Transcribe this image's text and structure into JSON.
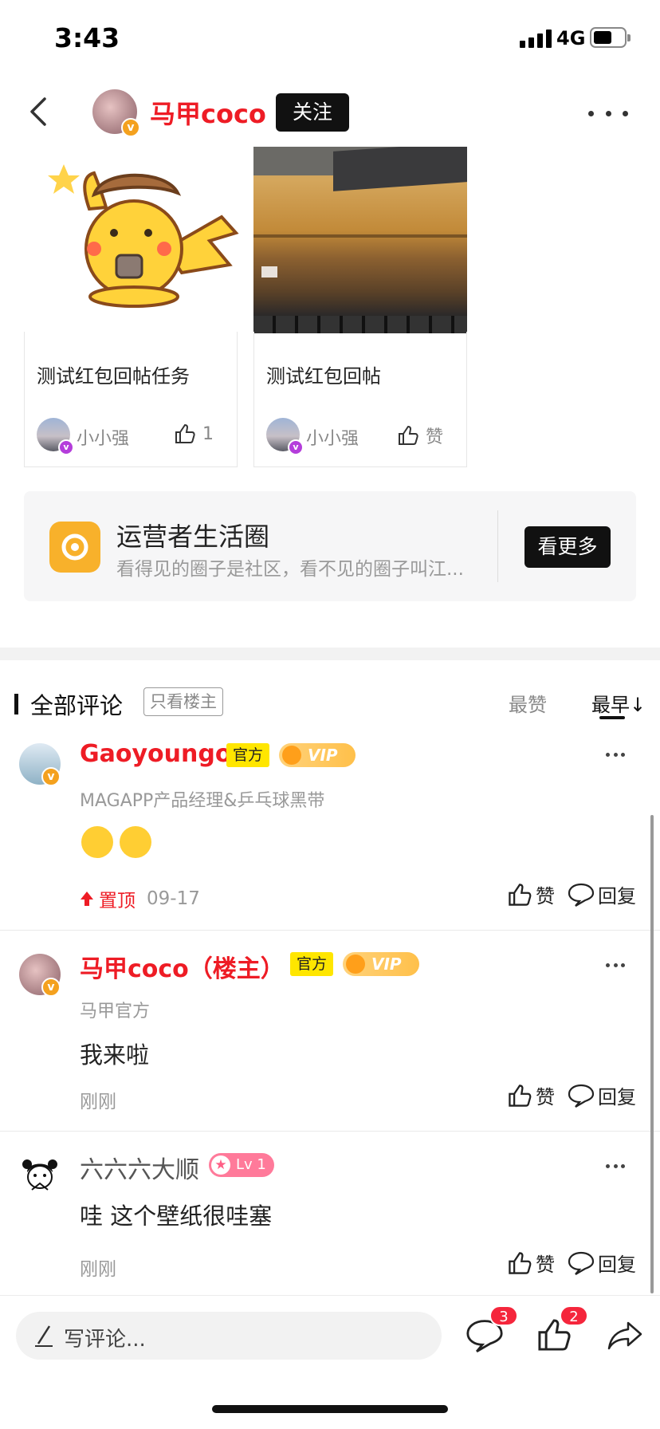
{
  "status_bar": {
    "time": "3:43",
    "network": "4G"
  },
  "header": {
    "author_name": "马甲coco",
    "follow_label": "关注"
  },
  "cards": [
    {
      "title": "测试红包回帖任务",
      "user": "小小强",
      "like_label": "1"
    },
    {
      "title": "测试红包回帖",
      "user": "小小强",
      "like_label": "赞"
    }
  ],
  "circle": {
    "title": "运营者生活圈",
    "description": "看得见的圈子是社区，看不见的圈子叫江...",
    "see_more_label": "看更多"
  },
  "comments_header": {
    "label": "全部评论",
    "only_op_label": "只看楼主",
    "sort_top_label": "最赞",
    "sort_early_label": "最早↓"
  },
  "comments": [
    {
      "name": "Gaoyoungor",
      "official_tag": "官方",
      "vip_tag": "VIP",
      "subtitle": "MAGAPP产品经理&乒乓球黑带",
      "pinned_label": "置顶",
      "time": "09-17",
      "like_label": "赞",
      "reply_label": "回复"
    },
    {
      "name": "马甲coco（楼主）",
      "official_tag": "官方",
      "vip_tag": "VIP",
      "subtitle": "马甲官方",
      "text": "我来啦",
      "time": "刚刚",
      "like_label": "赞",
      "reply_label": "回复"
    },
    {
      "name": "六六六大顺",
      "level_tag": "Lv 1",
      "text": "哇 这个壁纸很哇塞",
      "time": "刚刚",
      "like_label": "赞",
      "reply_label": "回复"
    }
  ],
  "bottom_bar": {
    "comment_placeholder": "写评论...",
    "comment_count": "3",
    "like_count": "2"
  },
  "colors": {
    "accent_red": "#ee1c25",
    "official_yellow": "#ffe600",
    "circle_logo": "#f8b12b"
  }
}
